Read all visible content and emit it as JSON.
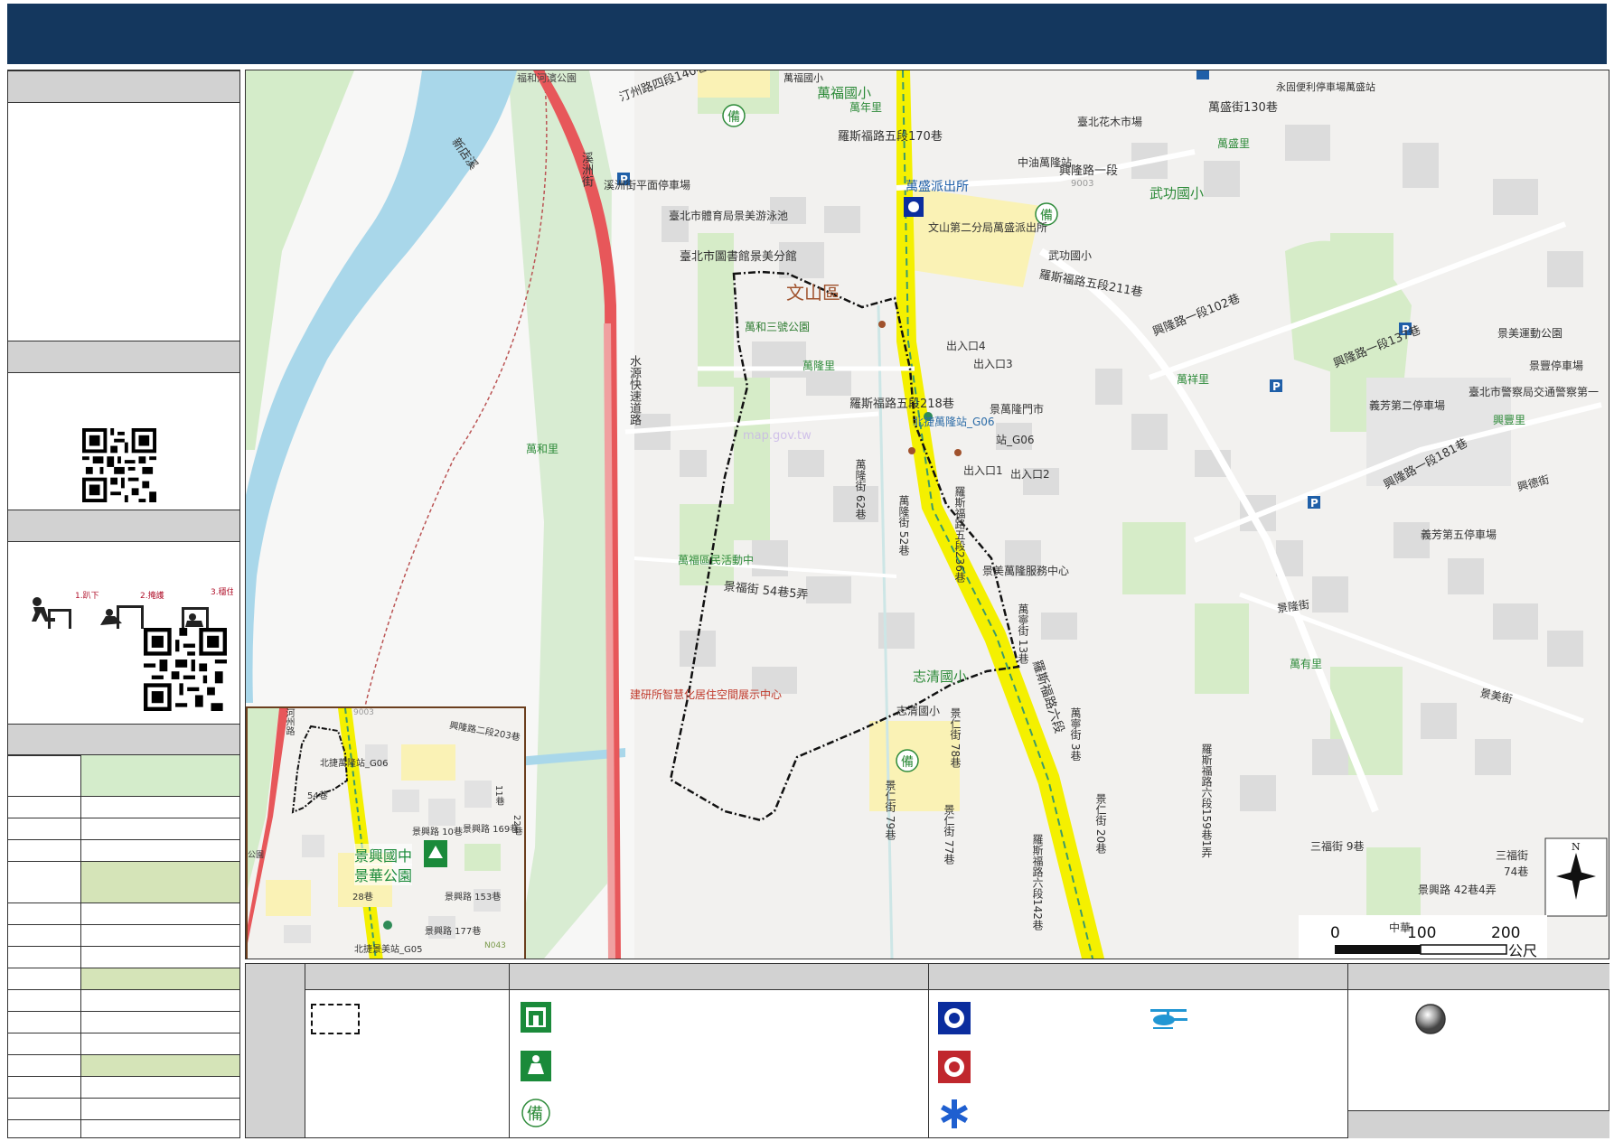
{
  "map": {
    "district_label": "文山區",
    "labels": {
      "fuhe_park": "福和河濱公園",
      "zhouhe_rd": "汀州路四段140巷",
      "wanfu_elem_top": "萬福國小",
      "wanfu_elem_school": "萬福國小",
      "wannian_li": "萬年里",
      "luosifu_170": "羅斯福路五段170巷",
      "xizhou_st": "溪洲街",
      "xizhou_parking": "溪洲街平面停車場",
      "pool": "臺北市體育局景美游泳池",
      "library": "臺北市圖書館景美分館",
      "xindian_river": "新店溪",
      "wanhe_park": "萬和三號公園",
      "wanlong_li": "萬隆里",
      "wanhe_li": "萬和里",
      "water_expressway": "水源快速道路",
      "luosifu_218": "羅斯福路五段218巷",
      "beijie_wanlong": "北捷萬隆站_G06",
      "exit4": "出入口4",
      "exit3": "出入口3",
      "exit1": "出入口1",
      "exit2": "出入口2",
      "wanlong_market": "景萬隆門市",
      "station_g06": "站_G06",
      "wanfu_activity": "萬福區民活動中",
      "wansheng_police": "萬盛派出所",
      "police_branch": "文山第二分局萬盛派出所",
      "wugong_elem": "武功國小",
      "wugong_elem2": "武功國小",
      "cpc_station": "中油萬隆站",
      "huamu_market": "臺北花木市場",
      "wansheng_130": "萬盛街130巷",
      "yongguo_parking": "永固便利停車場萬盛站",
      "wansheng_li": "萬盛里",
      "xinglong_1": "興隆路一段",
      "road_9003": "9003",
      "luosifu_211": "羅斯福路五段211巷",
      "xinglong_102": "興隆路一段102巷",
      "xinglong_137": "興隆路一段137巷",
      "jingmei_park": "景美運動公園",
      "jingmei_parking": "景豐停車場",
      "yifang_2": "義芳第二停車場",
      "traffic_police": "臺北市警察局交通警察第一",
      "xingfeng_li": "興豐里",
      "wanxiang_li": "萬祥里",
      "xinglong_181": "興隆路一段181巷",
      "xingde_st": "興德街",
      "yifang_5": "義芳第五停車場",
      "jingfu_54_5": "景福街 54巷5弄",
      "jianyan": "建研所智慧化居住空間展示中心",
      "zhiqing_elem": "志清國小",
      "zhiqing_elem2": "志清國小",
      "luosifu_6": "羅斯福路六段",
      "wanyou_li": "萬有里",
      "jinglong_st": "景隆街",
      "jingxing_42": "景興路 42巷4弄",
      "sanfu_9": "三福街 9巷",
      "sanfu_74": "三福街",
      "sanfu_74b": "74巷",
      "wanlong_service": "景美萬隆服務中心",
      "jingmei_st": "景美街",
      "zhonghua": "中華",
      "wanlong_st_62": "萬隆街 62巷",
      "wanlong_st_52": "萬隆街 52巷",
      "luosifu_236": "羅斯福路五段236巷",
      "wanning_13": "萬寧街 13巷",
      "wanning_3": "萬寧街 3巷",
      "jingren_78": "景仁街 78巷",
      "jingren_79": "景仁街 79巷",
      "jingren_77": "景仁街 77巷",
      "jingren_20": "景仁街 20巷",
      "luosifu_142": "羅斯福路六段142巷",
      "luosifu_159": "羅斯福路六段159巷1弄",
      "watermark": "map.gov.tw"
    },
    "scale": {
      "tick_0": "0",
      "tick_100": "100",
      "tick_200": "200",
      "unit": "公尺"
    },
    "north_label": "N"
  },
  "inset": {
    "labels": {
      "zhouhe": "河州路",
      "g06": "北捷萬隆站_G06",
      "road_9003": "9003",
      "xinglong_203": "興隆路二段203巷",
      "jingxing_10": "景興路 10巷",
      "jingxing_169": "景興路 169巷",
      "lane_54": "54巷",
      "park": "公園",
      "jingxing_junior": "景興國中",
      "jinghua_park": "景華公園",
      "lane_28": "28巷",
      "jingxing_153": "景興路 153巷",
      "jingxing_177": "景興路 177巷",
      "g05": "北捷景美站_G05",
      "n043": "N043",
      "lane_22": "22巷",
      "lane_11": "11巷"
    }
  },
  "sidebar": {
    "instructions": {
      "step1": "1.趴下",
      "step2": "2.掩護",
      "step3": "3.穩住"
    }
  },
  "colors": {
    "header": "#14375e",
    "river": "#a9d7ea",
    "mrt_line": "#f4f000",
    "expressway": "#e7575a",
    "greenbar": "#d4eccb",
    "greenbar2": "#d5e4b8",
    "section_gray": "#d2d2d2"
  },
  "icons": [
    "police-icon",
    "fire-icon",
    "medical-icon",
    "helicopter-icon",
    "shelter-icon",
    "park-shelter-icon",
    "stockpile-icon",
    "station-marker-icon",
    "parking-icon",
    "compass-icon",
    "qr-code-icon",
    "drop-cover-icon"
  ]
}
